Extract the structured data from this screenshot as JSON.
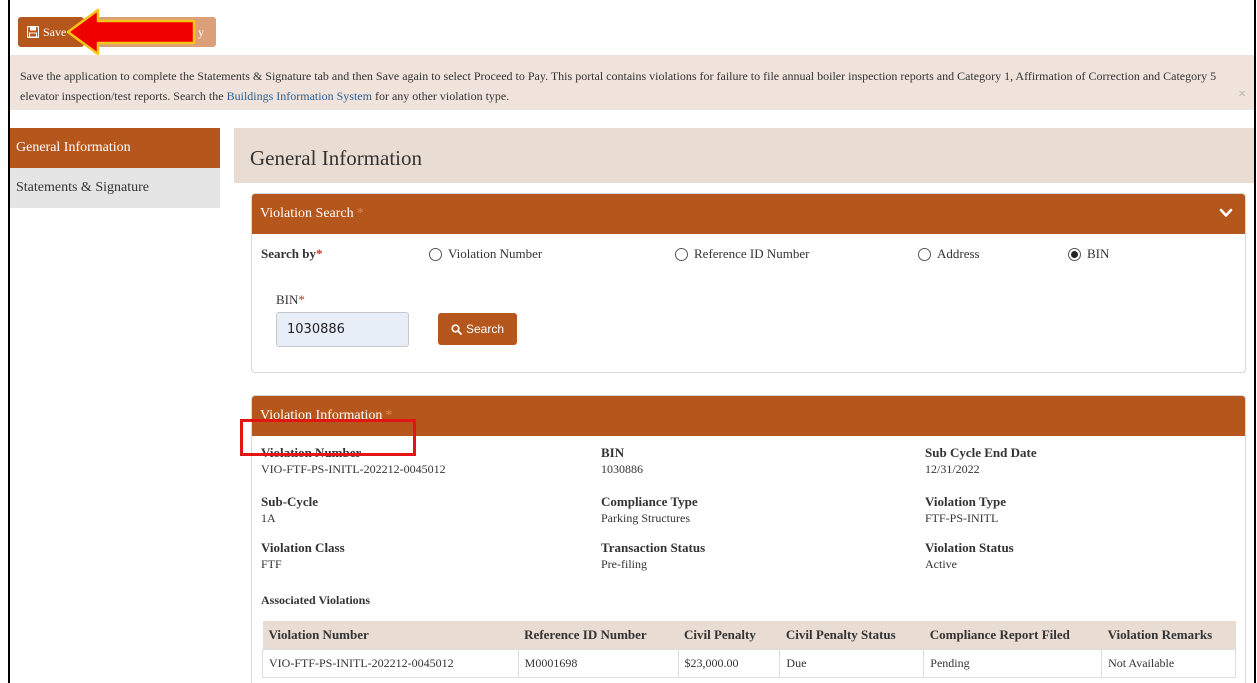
{
  "toolbar": {
    "save_label": "Save",
    "pay_label": "Proceed to Pay",
    "pay_visible_label": "y"
  },
  "notice": {
    "text_part1": "Save the application to complete the Statements & Signature tab and then Save again to select Proceed to Pay. This portal contains violations for failure to file annual boiler inspection reports and Category 1, Affirmation of Correction and Category 5 elevator inspection/test reports. Search the ",
    "link_text": "Buildings Information System",
    "text_part2": " for any other violation type.",
    "close_glyph": "×"
  },
  "sidebar": {
    "items": [
      {
        "label": "General Information",
        "active": true
      },
      {
        "label": "Statements & Signature",
        "active": false
      }
    ]
  },
  "page": {
    "title": "General Information"
  },
  "violation_search": {
    "header": "Violation Search",
    "required_mark": "*",
    "search_by_label": "Search by",
    "options": [
      {
        "label": "Violation Number",
        "selected": false
      },
      {
        "label": "Reference ID Number",
        "selected": false
      },
      {
        "label": "Address",
        "selected": false
      },
      {
        "label": "BIN",
        "selected": true
      }
    ],
    "bin_label": "BIN",
    "bin_value": "1030886",
    "search_button": "Search"
  },
  "violation_info": {
    "header": "Violation Information",
    "required_mark": "*",
    "fields": {
      "violation_number": {
        "label": "Violation Number",
        "value": "VIO-FTF-PS-INITL-202212-0045012"
      },
      "bin": {
        "label": "BIN",
        "value": "1030886"
      },
      "sub_cycle_end_date": {
        "label": "Sub Cycle End Date",
        "value": "12/31/2022"
      },
      "sub_cycle": {
        "label": "Sub-Cycle",
        "value": "1A"
      },
      "compliance_type": {
        "label": "Compliance Type",
        "value": "Parking Structures"
      },
      "violation_type": {
        "label": "Violation Type",
        "value": "FTF-PS-INITL"
      },
      "violation_class": {
        "label": "Violation Class",
        "value": "FTF"
      },
      "transaction_status": {
        "label": "Transaction Status",
        "value": "Pre-filing"
      },
      "violation_status": {
        "label": "Violation Status",
        "value": "Active"
      }
    },
    "associated_label": "Associated Violations",
    "table": {
      "columns": [
        "Violation Number",
        "Reference ID Number",
        "Civil Penalty",
        "Civil Penalty Status",
        "Compliance Report Filed",
        "Violation Remarks"
      ],
      "rows": [
        [
          "VIO-FTF-PS-INITL-202212-0045012",
          "M0001698",
          "$23,000.00",
          "Due",
          "Pending",
          "Not Available"
        ]
      ]
    }
  },
  "colors": {
    "brand": "#b5561c",
    "brand_light": "#dba07a",
    "notice_bg": "#efe3dc",
    "header_bg": "#e9dcd3",
    "annotation_red": "#e31414",
    "arrow_fill": "#f00000",
    "arrow_outline": "#f5c518"
  }
}
